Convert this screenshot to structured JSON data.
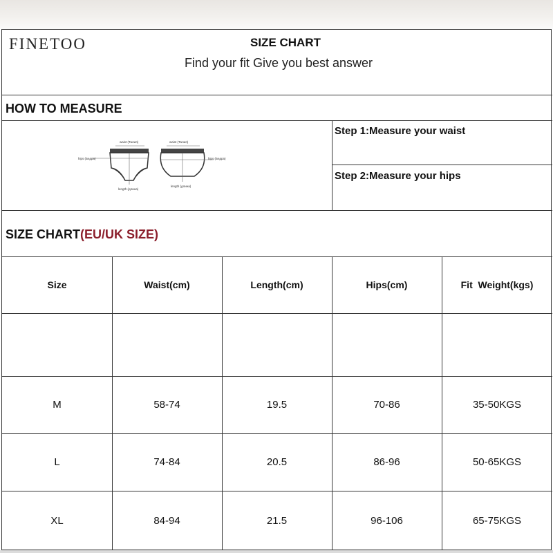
{
  "brand": {
    "logo": "FINETOO"
  },
  "header": {
    "title": "SIZE CHART",
    "subtitle": "Find your fit Give you best answer"
  },
  "measure": {
    "heading": "HOW TO MEASURE",
    "step1": "Step 1:Measure your waist",
    "step2": "Step 2:Measure your hips",
    "diagram_labels": {
      "waist_left": "waist (Талия)",
      "hips_left": "hips (Бедра)",
      "length_left": "length (длина)",
      "waist_right": "waist (Талия)",
      "hips_right": "hips (Бедра)",
      "length_right": "length (длина)"
    }
  },
  "size_chart": {
    "heading_main": "SIZE CHART",
    "heading_accent": "(EU/UK SIZE)",
    "columns": [
      "Size",
      "Waist(cm)",
      "Length(cm)",
      "Hips(cm)",
      "Fit  Weight(kgs)"
    ],
    "rows": [
      [
        "",
        "",
        "",
        "",
        ""
      ],
      [
        "M",
        "58-74",
        "19.5",
        "70-86",
        "35-50KGS"
      ],
      [
        "L",
        "74-84",
        "20.5",
        "86-96",
        "50-65KGS"
      ],
      [
        "XL",
        "84-94",
        "21.5",
        "96-106",
        "65-75KGS"
      ]
    ]
  },
  "colors": {
    "accent": "#8b1e2b",
    "border": "#333333"
  }
}
